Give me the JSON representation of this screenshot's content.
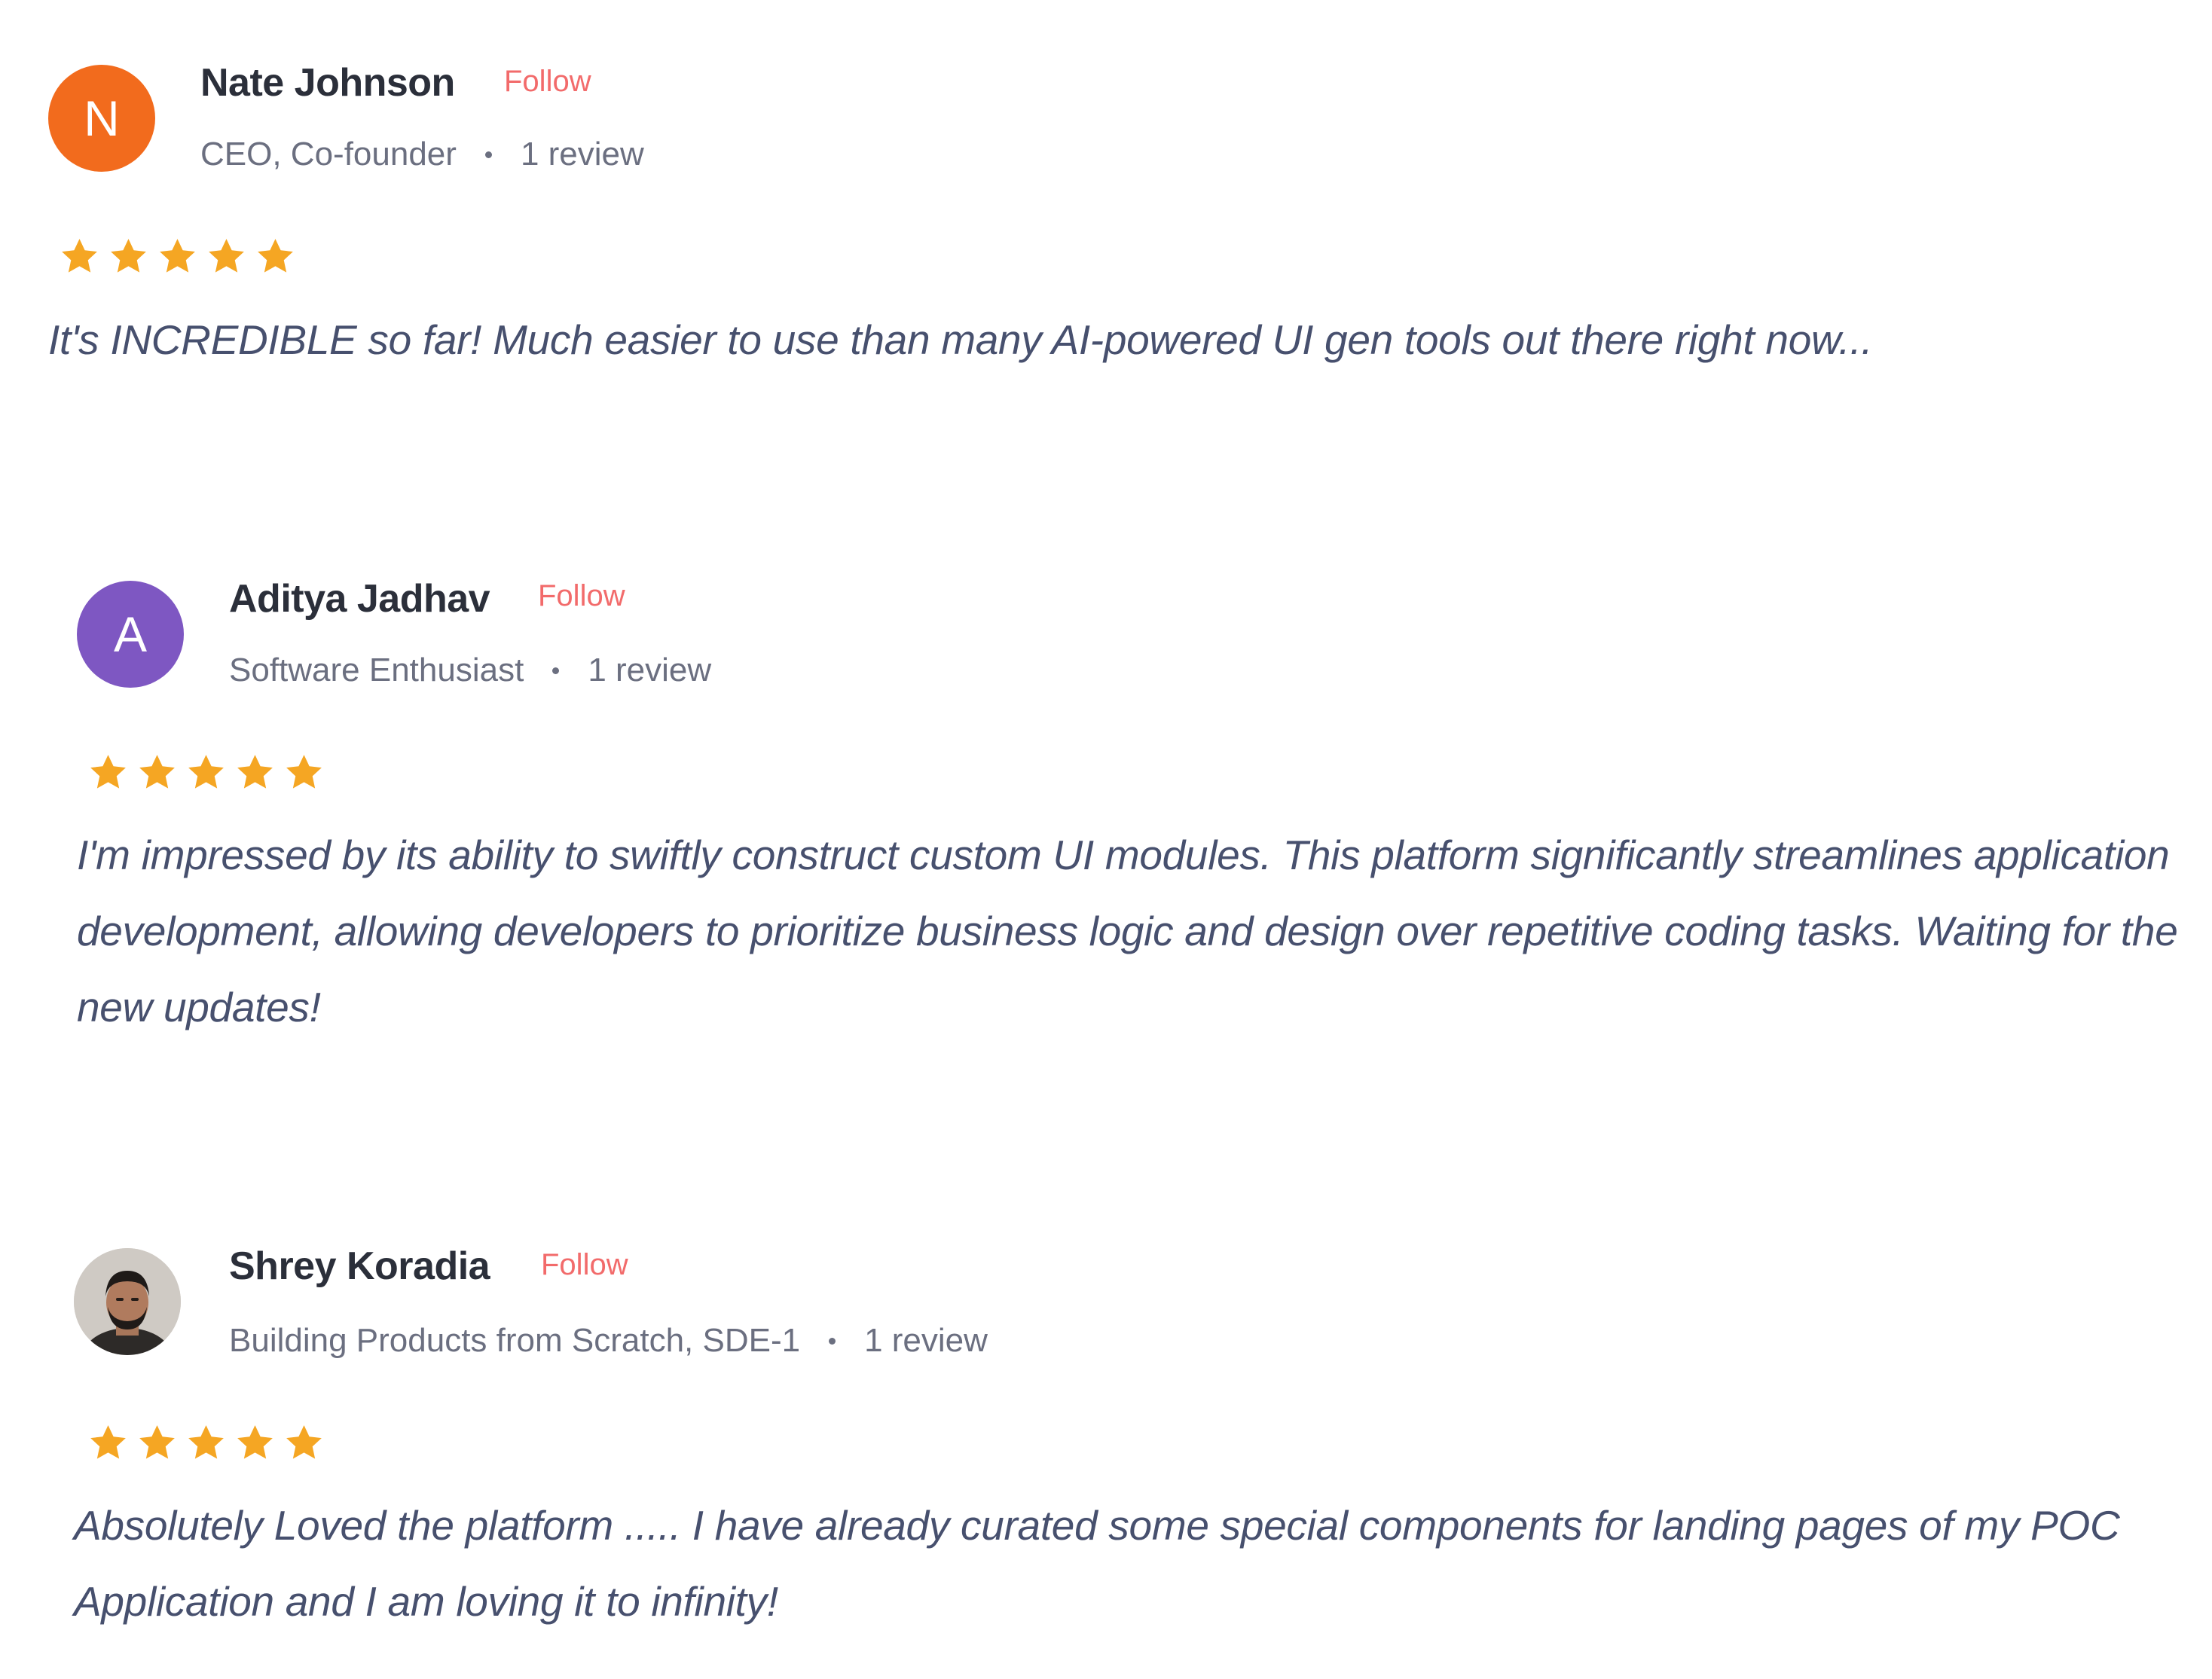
{
  "reviews": [
    {
      "avatar_initial": "N",
      "avatar_color": "#f26b1d",
      "name": "Nate Johnson",
      "follow_label": "Follow",
      "title": "CEO, Co-founder",
      "review_count": "1 review",
      "rating": 5,
      "text": "It's INCREDIBLE so far! Much easier to use than many AI-powered UI gen tools out there right now..."
    },
    {
      "avatar_initial": "A",
      "avatar_color": "#7e57c2",
      "name": "Aditya Jadhav",
      "follow_label": "Follow",
      "title": "Software Enthusiast",
      "review_count": "1 review",
      "rating": 5,
      "text": "I'm impressed by its ability to swiftly construct custom UI modules. This platform significantly streamlines application development, allowing developers to prioritize business logic and design over repetitive coding tasks. Waiting for the new updates!"
    },
    {
      "avatar_initial": "",
      "avatar_color": "#c9c4bf",
      "name": "Shrey Koradia",
      "follow_label": "Follow",
      "title": "Building Products from Scratch, SDE-1",
      "review_count": "1 review",
      "rating": 5,
      "text": "Absolutely Loved the platform ..... I have already curated some special components for landing pages of my POC Application and I am loving it to infinity!"
    }
  ],
  "star_color": "#f5a623"
}
